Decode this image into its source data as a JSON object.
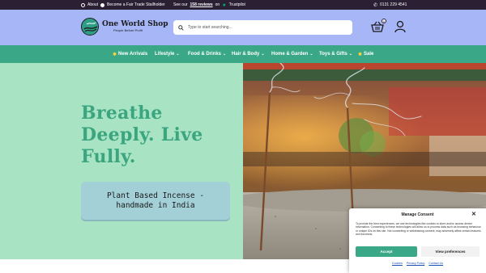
{
  "topbar": {
    "about": "About",
    "stallholder": "Become a Fair Trade Stallholder",
    "reviews_prefix": "See our",
    "reviews_link": "158 reviews",
    "reviews_on": "on",
    "trustpilot": "Trustpilot",
    "phone": "0131 229 4541"
  },
  "header": {
    "logo_title": "One World Shop",
    "logo_tagline": "People Before Profit",
    "search_placeholder": "Type to start searching...",
    "basket_count": "0"
  },
  "nav": {
    "items": [
      {
        "label": "New Arrivals",
        "icon": "star-icon"
      },
      {
        "label": "Lifestyle",
        "icon": "chevron-down-icon"
      },
      {
        "label": "Food & Drinks",
        "icon": "chevron-down-icon"
      },
      {
        "label": "Hair & Body",
        "icon": "chevron-down-icon"
      },
      {
        "label": "Home & Garden",
        "icon": "chevron-down-icon"
      },
      {
        "label": "Toys & Gifts",
        "icon": "chevron-down-icon"
      },
      {
        "label": "Sale",
        "icon": "star-icon"
      }
    ]
  },
  "hero": {
    "title": "Breathe Deeply. Live Fully.",
    "cta": "Plant Based Incense - handmade in India"
  },
  "cookie": {
    "title": "Manage Consent",
    "body": "To provide the best experiences, we use technologies like cookies to store and/or access device information. Consenting to these technologies will allow us to process data such as browsing behaviour or unique IDs on this site. Not consenting or withdrawing consent, may adversely affect certain features and functions.",
    "accept": "Accept",
    "preferences": "View preferences",
    "links": [
      "Cookies",
      "Privacy Policy",
      "Contact Us"
    ]
  },
  "colors": {
    "topbar": "#2a1f33",
    "header": "#a7b6f7",
    "nav": "#3aa886",
    "hero_left": "#a8e4c4",
    "hero_title": "#3aa57f",
    "cta": "#a3cfd6"
  }
}
